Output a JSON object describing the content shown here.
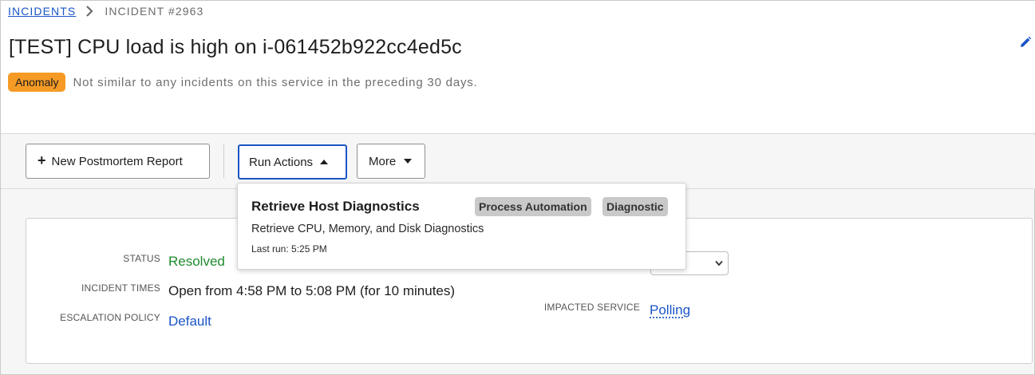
{
  "breadcrumb": {
    "incidents_link": "INCIDENTS",
    "current": "INCIDENT #2963"
  },
  "incident": {
    "title": "[TEST] CPU load is high on i-061452b922cc4ed5c",
    "anomaly_badge": "Anomaly",
    "anomaly_text": "Not similar to any incidents on this service in the preceding 30 days."
  },
  "toolbar": {
    "postmortem_label": "New Postmortem Report",
    "run_actions_label": "Run Actions",
    "more_label": "More"
  },
  "run_actions_menu": {
    "items": [
      {
        "title": "Retrieve Host Diagnostics",
        "tags": [
          "Process Automation",
          "Diagnostic"
        ],
        "description": "Retrieve CPU, Memory, and Disk Diagnostics",
        "last_run": "Last run: 5:25 PM"
      }
    ]
  },
  "details": {
    "status_label": "STATUS",
    "status_value": "Resolved",
    "times_label": "INCIDENT TIMES",
    "times_value": "Open from 4:58 PM to 5:08 PM (for 10 minutes)",
    "escalation_label": "ESCALATION POLICY",
    "escalation_value": "Default",
    "impacted_label": "IMPACTED SERVICE",
    "impacted_value": "Polling"
  },
  "colors": {
    "link": "#1a55c6",
    "anomaly": "#f59b25",
    "resolved": "#1e8a2e",
    "tag_bg": "#c9c9c9"
  },
  "icons": [
    "chevron-right-icon",
    "pencil-icon",
    "plus-icon",
    "caret-up-icon",
    "caret-down-icon",
    "chevron-down-icon"
  ]
}
